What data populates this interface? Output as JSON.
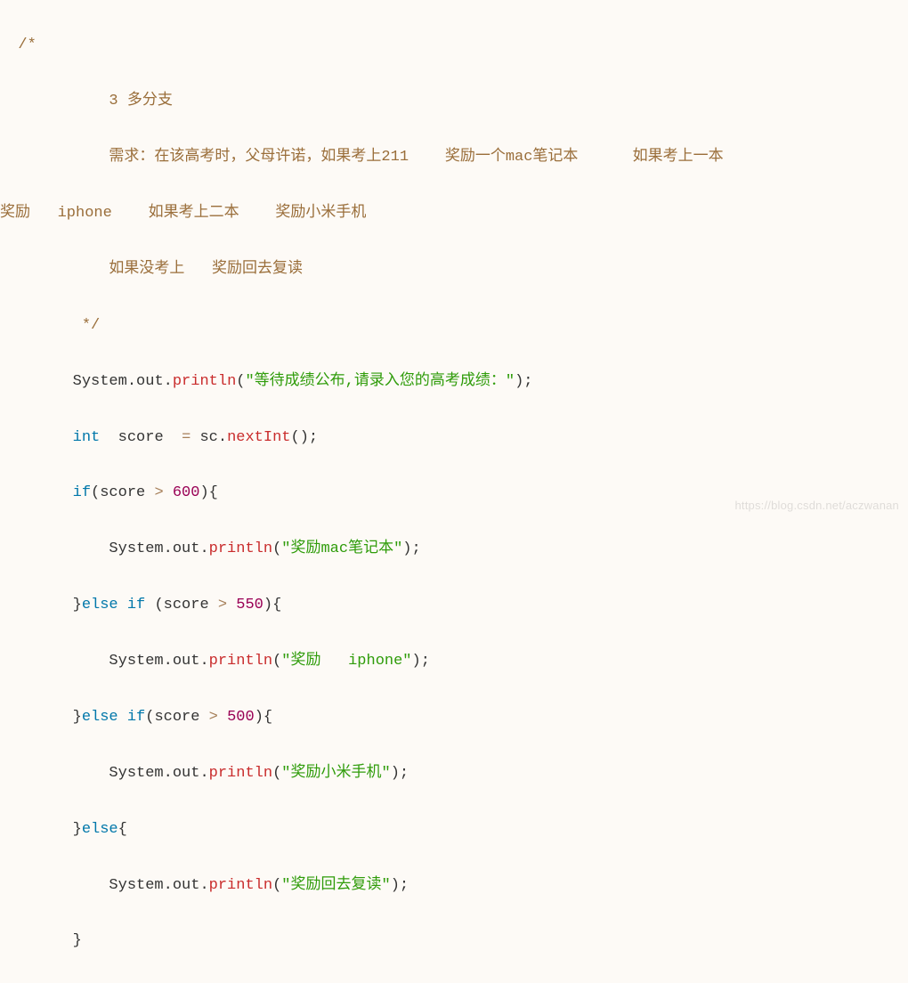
{
  "code": {
    "c_open": "/*",
    "c_line1_a": "            3 多分支",
    "c_line2_a": "            需求：在该高考时，父母许诺，如果考上211    奖励一个mac笔记本      如果考上一本",
    "c_line3_a": "奖励   iphone    如果考上二本    奖励小米手机",
    "c_line4_a": "            如果没考上   奖励回去复读",
    "c_close": "         */",
    "sys": "System",
    "out": "out",
    "println": "println",
    "str_prompt": "\"等待成绩公布,请录入您的高考成绩：\"",
    "kw_int": "int",
    "id_score": "score",
    "eq": "=",
    "id_sc": "sc",
    "nextInt": "nextInt",
    "kw_if": "if",
    "kw_else": "else",
    "gt": ">",
    "n600": "600",
    "n550": "550",
    "n500": "500",
    "str_mac": "\"奖励mac笔记本\"",
    "str_iphone": "\"奖励   iphone\"",
    "str_xiaomi": "\"奖励小米手机\"",
    "str_repeat": "\"奖励回去复读\"",
    "semi": ";",
    "lp": "(",
    "rp": ")",
    "lb": "{",
    "rb": "}",
    "dot": ".",
    "sp8": "        ",
    "sp12": "            ",
    "watermark": "https://blog.csdn.net/aczwanan"
  }
}
